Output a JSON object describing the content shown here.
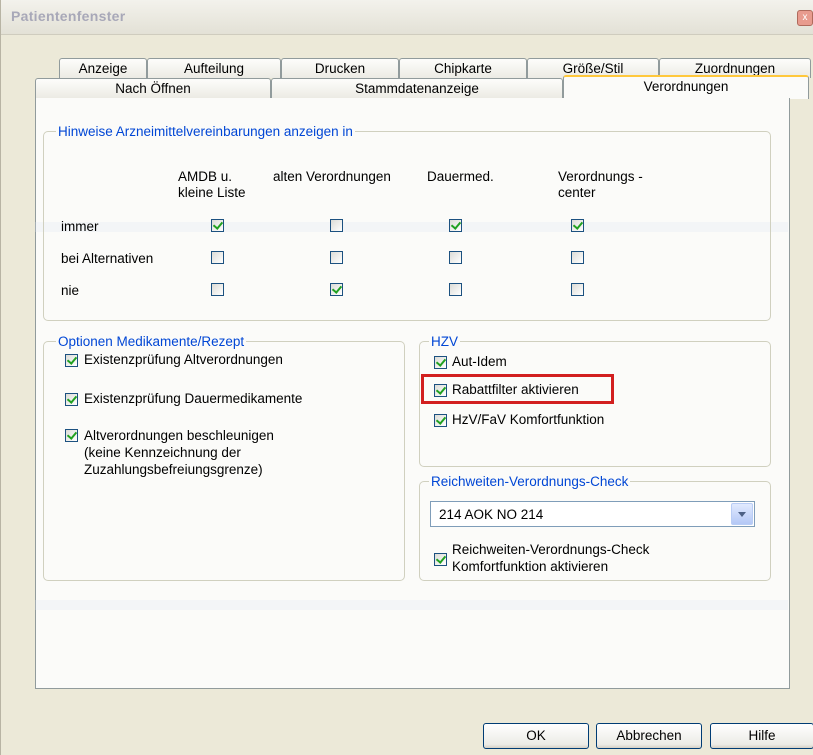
{
  "window": {
    "title": "Patientenfenster",
    "close_symbol": "x"
  },
  "tabs": {
    "row1": [
      "Anzeige",
      "Aufteilung",
      "Drucken",
      "Chipkarte",
      "Größe/Stil",
      "Zuordnungen"
    ],
    "row2": [
      "Nach Öffnen",
      "Stammdatenanzeige",
      "Verordnungen"
    ],
    "active": "Verordnungen"
  },
  "hinweise": {
    "title": "Hinweise Arzneimittelvereinbarungen anzeigen in",
    "columns": [
      {
        "line1": "AMDB u.",
        "line2": "kleine Liste"
      },
      {
        "line1": "alten Verordnungen",
        "line2": ""
      },
      {
        "line1": "Dauermed.",
        "line2": ""
      },
      {
        "line1": "Verordnungs -",
        "line2": "center"
      }
    ],
    "rows": [
      {
        "label": "immer",
        "checked": [
          true,
          false,
          true,
          true
        ]
      },
      {
        "label": "bei Alternativen",
        "checked": [
          false,
          false,
          false,
          false
        ]
      },
      {
        "label": "nie",
        "checked": [
          false,
          true,
          false,
          false
        ]
      }
    ]
  },
  "optionen": {
    "title": "Optionen Medikamente/Rezept",
    "items": [
      {
        "label": "Existenzprüfung Altverordnungen",
        "checked": true
      },
      {
        "label": "Existenzprüfung Dauermedikamente",
        "checked": true
      },
      {
        "label": "Altverordnungen beschleunigen",
        "line2": "(keine Kennzeichnung der",
        "line3": "Zuzahlungsbefreiungsgrenze)",
        "checked": true
      }
    ]
  },
  "hzv": {
    "title": "HZV",
    "items": [
      {
        "label": "Aut-Idem",
        "checked": true
      },
      {
        "label": "Rabattfilter aktivieren",
        "checked": true
      },
      {
        "label": "HzV/FaV Komfortfunktion",
        "checked": true
      }
    ]
  },
  "reichweiten": {
    "title": "Reichweiten-Verordnungs-Check",
    "select_value": "214   AOK NO 214",
    "checkbox_line1": "Reichweiten-Verordnungs-Check",
    "checkbox_line2": "Komfortfunktion aktivieren",
    "checked": true
  },
  "buttons": {
    "ok": "OK",
    "cancel": "Abbrechen",
    "help": "Hilfe"
  },
  "colors": {
    "group_title": "#0046d5",
    "highlight": "#d21f1f",
    "active_tab_accent": "#ffc83c"
  }
}
